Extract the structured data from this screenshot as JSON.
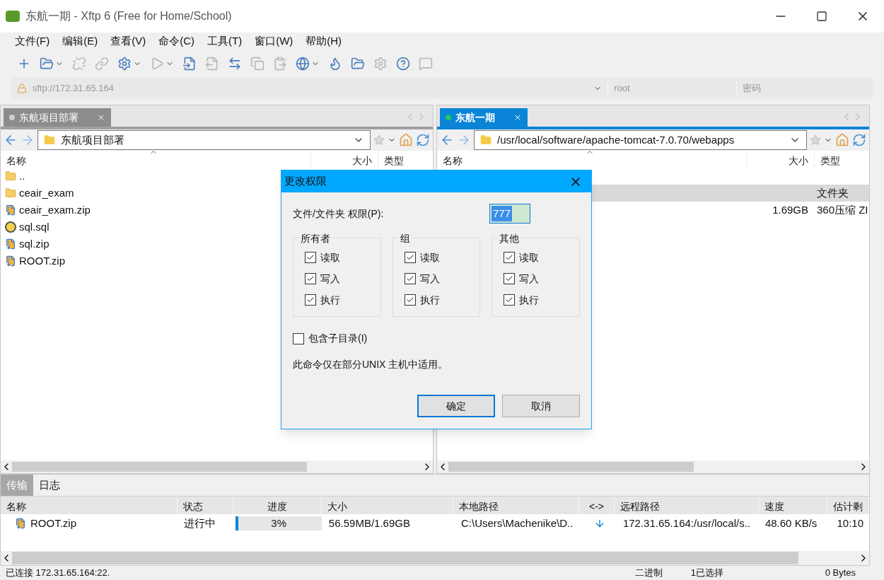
{
  "window": {
    "title": "东航一期 - Xftp 6 (Free for Home/School)"
  },
  "menu": [
    "文件(F)",
    "编辑(E)",
    "查看(V)",
    "命令(C)",
    "工具(T)",
    "窗口(W)",
    "帮助(H)"
  ],
  "address": {
    "url": "sftp://172.31.65.164",
    "user": "root",
    "password_placeholder": "密码"
  },
  "left_pane": {
    "tab": {
      "label": "东航项目部署",
      "selected": false,
      "connected": false
    },
    "path": "东航项目部署",
    "columns": [
      "名称",
      "大小",
      "类型"
    ],
    "rows": [
      {
        "name": "..",
        "kind": "folder"
      },
      {
        "name": "ceair_exam",
        "kind": "folder"
      },
      {
        "name": "ceair_exam.zip",
        "kind": "zip"
      },
      {
        "name": "sql.sql",
        "kind": "script"
      },
      {
        "name": "sql.zip",
        "kind": "zip"
      },
      {
        "name": "ROOT.zip",
        "kind": "zip"
      }
    ]
  },
  "right_pane": {
    "tab": {
      "label": "东航一期",
      "selected": true,
      "connected": true
    },
    "path": "/usr/local/software/apache-tomcat-7.0.70/webapps",
    "columns": [
      "名称",
      "大小",
      "类型"
    ],
    "rows": [
      {
        "size": "",
        "type": "文件夹",
        "selected": true
      },
      {
        "size": "1.69GB",
        "type": "360压缩 ZI",
        "selected": false
      }
    ]
  },
  "transfer": {
    "tabs": [
      {
        "label": "传输",
        "selected": true
      },
      {
        "label": "日志",
        "selected": false
      }
    ],
    "columns": [
      "名称",
      "状态",
      "进度",
      "大小",
      "本地路径",
      "<->",
      "远程路径",
      "速度",
      "估计剩"
    ],
    "rows": [
      {
        "name": "ROOT.zip",
        "status": "进行中",
        "level": 0.03,
        "progress": "3%",
        "size": "56.59MB/1.69GB",
        "local": "C:\\Users\\Machenike\\D..",
        "remote": "172.31.65.164:/usr/local/s..",
        "speed": "48.60 KB/s",
        "eta": "10:10"
      }
    ]
  },
  "status_bar": {
    "connection": "已连接 172.31.65.164:22.",
    "mode": "二进制",
    "selection": "1已选择",
    "size": "0 Bytes"
  },
  "dialog": {
    "title": "更改权限",
    "field_label": "文件/文件夹 权限(P):",
    "value": "777",
    "groups": [
      {
        "title": "所有者",
        "items": [
          {
            "label": "读取",
            "checked": true
          },
          {
            "label": "写入",
            "checked": true
          },
          {
            "label": "执行",
            "checked": true
          }
        ]
      },
      {
        "title": "组",
        "items": [
          {
            "label": "读取",
            "checked": true
          },
          {
            "label": "写入",
            "checked": true
          },
          {
            "label": "执行",
            "checked": true
          }
        ]
      },
      {
        "title": "其他",
        "items": [
          {
            "label": "读取",
            "checked": true
          },
          {
            "label": "写入",
            "checked": true
          },
          {
            "label": "执行",
            "checked": true
          }
        ]
      }
    ],
    "subdirs": {
      "label": "包含子目录(I)",
      "checked": false
    },
    "note": "此命令仅在部分UNIX 主机中适用。",
    "buttons": [
      {
        "label": "确定",
        "default": true
      },
      {
        "label": "取消",
        "default": false
      }
    ]
  }
}
